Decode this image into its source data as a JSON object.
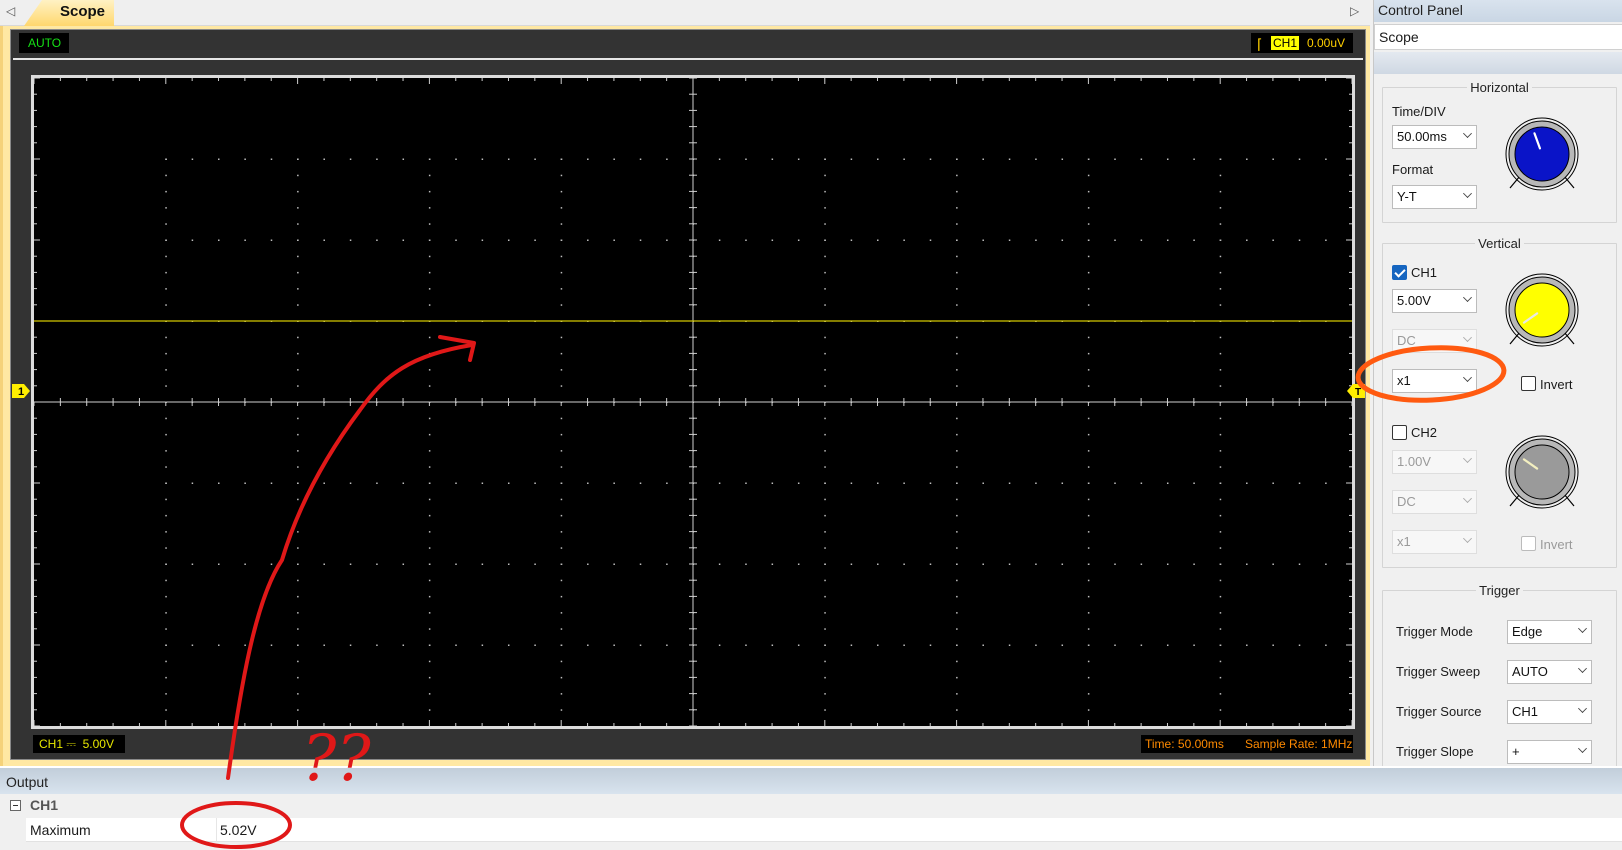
{
  "tabs": [
    {
      "label": "Scope",
      "active": true
    }
  ],
  "scope": {
    "trigger_mode_badge": "AUTO",
    "trigger_channel": "CH1",
    "trigger_level": "0.00uV",
    "ch1_status_label": "CH1",
    "ch1_coupling_symbol": "⎓",
    "ch1_status_value": "5.00V",
    "time_status": "Time: 50.00ms",
    "sample_rate_status": "Sample Rate: 1MHz",
    "ch1_marker": "1",
    "trigger_marker": "T",
    "grid": {
      "h_divisions": 10,
      "v_divisions": 8,
      "minor_per_div": 5
    },
    "trace": {
      "channel": "CH1",
      "color": "#d4c800",
      "level_divs_above_center": 1.0
    }
  },
  "control_panel": {
    "title": "Control Panel",
    "selected": "Scope",
    "horizontal": {
      "title": "Horizontal",
      "time_div_label": "Time/DIV",
      "time_div_value": "50.00ms",
      "format_label": "Format",
      "format_value": "Y-T",
      "knob_color": "#0a14c8"
    },
    "vertical": {
      "title": "Vertical",
      "ch1": {
        "label": "CH1",
        "enabled": true,
        "volts_div": "5.00V",
        "coupling": "DC",
        "probe": "x1",
        "invert_label": "Invert",
        "invert": false,
        "knob_color": "#ffff00"
      },
      "ch2": {
        "label": "CH2",
        "enabled": false,
        "volts_div": "1.00V",
        "coupling": "DC",
        "probe": "x1",
        "invert_label": "Invert",
        "invert": false,
        "knob_color": "#9a9a9a"
      }
    },
    "trigger": {
      "title": "Trigger",
      "rows": [
        {
          "label": "Trigger Mode",
          "value": "Edge"
        },
        {
          "label": "Trigger Sweep",
          "value": "AUTO"
        },
        {
          "label": "Trigger Source",
          "value": "CH1"
        },
        {
          "label": "Trigger Slope",
          "value": "+"
        }
      ]
    }
  },
  "output": {
    "title": "Output",
    "group": "CH1",
    "rows": [
      {
        "key": "Maximum",
        "value": "5.02V"
      }
    ]
  },
  "annotations": {
    "question_marks": "??",
    "red_color": "#e01818",
    "orange_color": "#ff5a10"
  }
}
